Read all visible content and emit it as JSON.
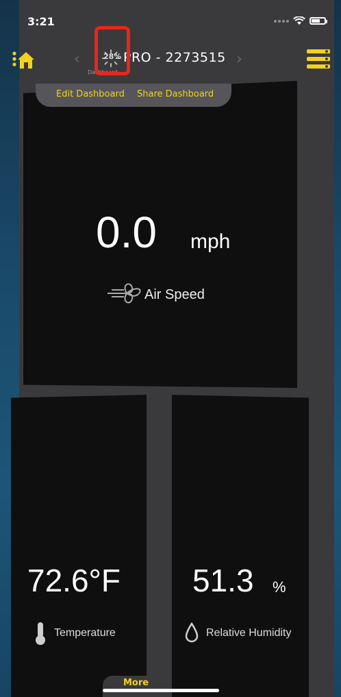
{
  "status_bar": {
    "time": "3:21",
    "battery_level": 0.6
  },
  "header": {
    "home_icon": "home-icon",
    "menu_icon": "menu-icon",
    "prev_icon": "chevron-left-icon",
    "next_icon": "chevron-right-icon",
    "progress_text": "28%",
    "device_title": "PRO - 2273515",
    "subtitle": "Dashboard",
    "accent_color": "#f2d21e",
    "highlight_color": "#e8261c"
  },
  "tabs": {
    "edit_label": "Edit Dashboard",
    "share_label": "Share Dashboard"
  },
  "air_speed": {
    "value": "0.0",
    "unit": "mph",
    "label": "Air Speed",
    "icon": "fan-icon"
  },
  "temperature": {
    "value": "72.6°F",
    "label": "Temperature",
    "icon": "thermometer-icon"
  },
  "humidity": {
    "value": "51.3",
    "unit": "%",
    "label": "Relative Humidity",
    "icon": "droplet-icon"
  },
  "footer": {
    "more_label": "More"
  }
}
